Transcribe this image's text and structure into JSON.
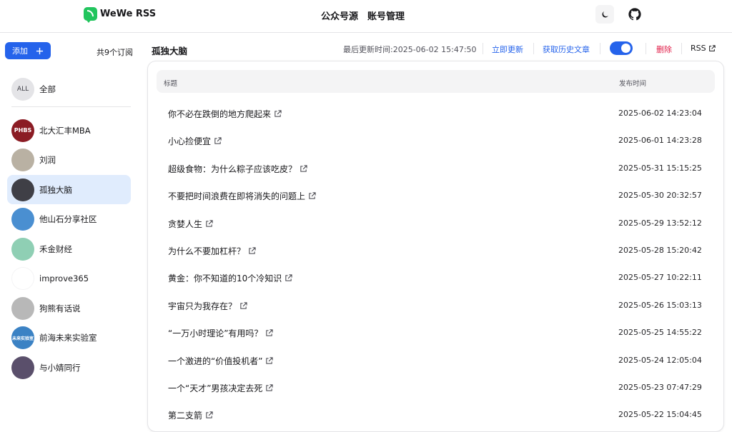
{
  "app": {
    "name": "WeWe RSS"
  },
  "nav": {
    "items": [
      "公众号源",
      "账号管理"
    ]
  },
  "sidebar": {
    "add_label": "添加",
    "sub_count": "共9个订阅",
    "all": {
      "badge": "ALL",
      "label": "全部"
    },
    "items": [
      {
        "label": "北大汇丰MBA",
        "badge": "PHBS",
        "color": "#8b1c24"
      },
      {
        "label": "刘润",
        "badge": "",
        "color": "#b9b1a3"
      },
      {
        "label": "孤独大脑",
        "badge": "",
        "color": "#3f3f46"
      },
      {
        "label": "他山石分享社区",
        "badge": "",
        "color": "#4a8fd1"
      },
      {
        "label": "禾金财经",
        "badge": "",
        "color": "#8fcfb4"
      },
      {
        "label": "improve365",
        "badge": "",
        "color": "#ffffff"
      },
      {
        "label": "狗熊有话说",
        "badge": "",
        "color": "#b8b8b8"
      },
      {
        "label": "前海未来实验室",
        "badge": "未来实验室",
        "color": "#3b82c4"
      },
      {
        "label": "与小婧同行",
        "badge": "",
        "color": "#5a4f6b"
      }
    ],
    "active_index": 2
  },
  "header": {
    "feed_title": "孤独大脑",
    "last_updated": "最后更新时间:2025-06-02 15:47:50",
    "update_now": "立即更新",
    "fetch_history": "获取历史文章",
    "delete": "删除",
    "rss": "RSS",
    "toggle_on": true
  },
  "table": {
    "col_title": "标题",
    "col_time": "发布时间",
    "rows": [
      {
        "title": "你不必在跌倒的地方爬起来",
        "time": "2025-06-02 14:23:04"
      },
      {
        "title": "小心捡便宜",
        "time": "2025-06-01 14:23:28"
      },
      {
        "title": "超级食物：为什么粽子应该吃皮？",
        "time": "2025-05-31 15:15:25"
      },
      {
        "title": "不要把时间浪费在即将消失的问题上",
        "time": "2025-05-30 20:32:57"
      },
      {
        "title": "贪婪人生",
        "time": "2025-05-29 13:52:12"
      },
      {
        "title": "为什么不要加杠杆？",
        "time": "2025-05-28 15:20:42"
      },
      {
        "title": "黄金：你不知道的10个冷知识",
        "time": "2025-05-27 10:22:11"
      },
      {
        "title": "宇宙只为我存在？",
        "time": "2025-05-26 15:03:13"
      },
      {
        "title": "“一万小时理论”有用吗？",
        "time": "2025-05-25 14:55:22"
      },
      {
        "title": "一个激进的“价值投机者”",
        "time": "2025-05-24 12:05:04"
      },
      {
        "title": "一个“天才”男孩决定去死",
        "time": "2025-05-23 07:47:29"
      },
      {
        "title": "第二支箭",
        "time": "2025-05-22 15:04:45"
      }
    ]
  },
  "colors": {
    "accent": "#2563eb",
    "danger": "#e11d48",
    "active_bg": "#e0ecfd"
  },
  "icons": {
    "theme": "moon-icon",
    "github": "github-icon",
    "external": "external-link-icon",
    "add": "plus-icon"
  }
}
